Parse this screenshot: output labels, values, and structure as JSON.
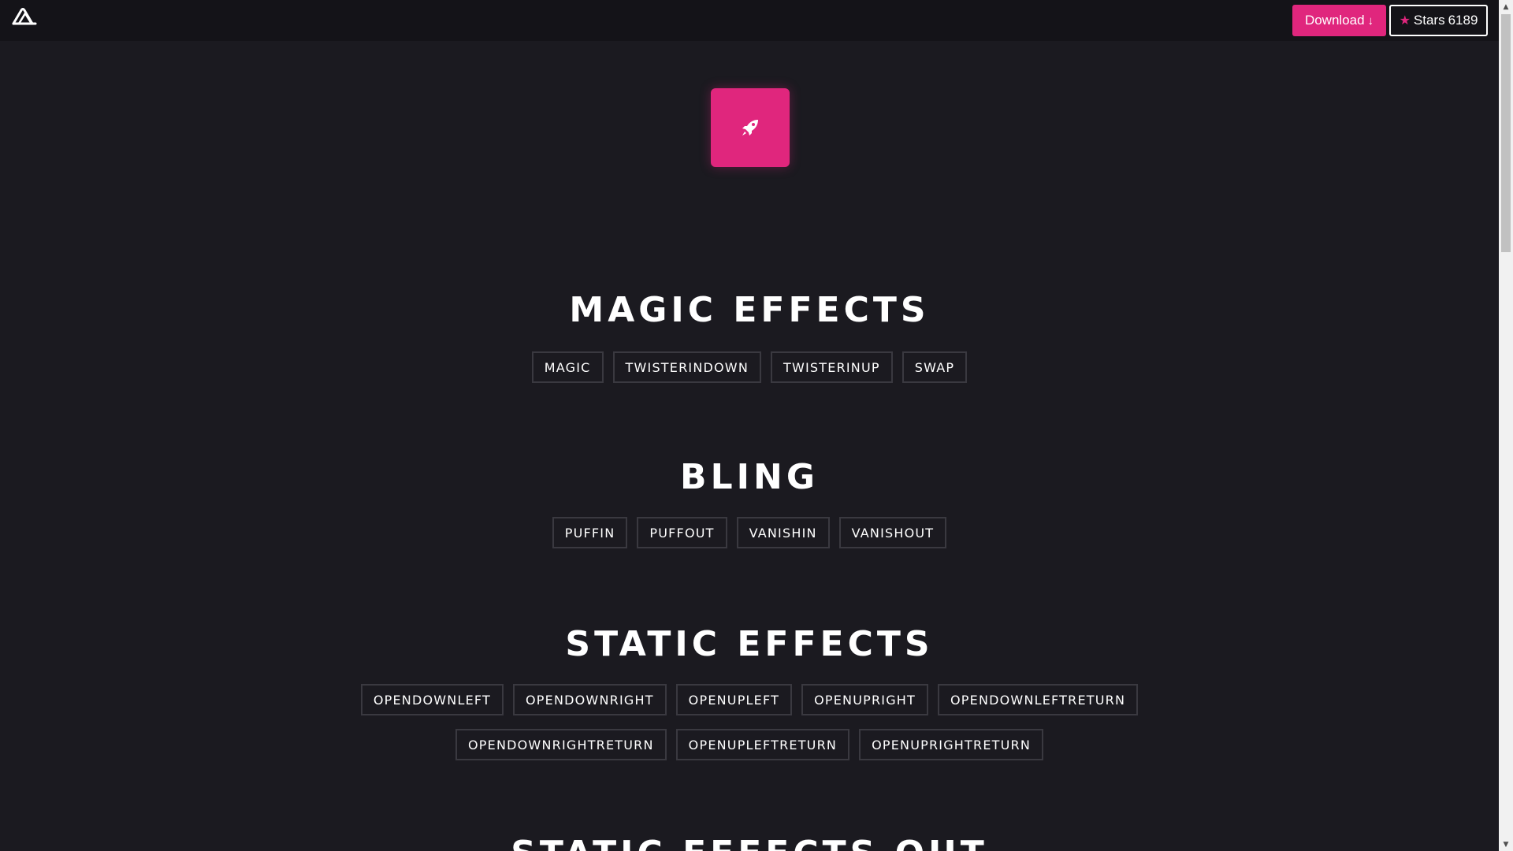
{
  "header": {
    "download_label": "Download",
    "stars_label": "Stars",
    "stars_count": "6189"
  },
  "hero": {
    "icon": "rocket-icon"
  },
  "sections": [
    {
      "title": "MAGIC EFFECTS",
      "rows": [
        [
          "MAGIC",
          "TWISTERINDOWN",
          "TWISTERINUP",
          "SWAP"
        ]
      ]
    },
    {
      "title": "BLING",
      "rows": [
        [
          "PUFFIN",
          "PUFFOUT",
          "VANISHIN",
          "VANISHOUT"
        ]
      ]
    },
    {
      "title": "STATIC EFFECTS",
      "rows": [
        [
          "OPENDOWNLEFT",
          "OPENDOWNRIGHT",
          "OPENUPLEFT",
          "OPENUPRIGHT",
          "OPENDOWNLEFTRETURN"
        ],
        [
          "OPENDOWNRIGHTRETURN",
          "OPENUPLEFTRETURN",
          "OPENUPRIGHTRETURN"
        ]
      ]
    },
    {
      "title": "STATIC EFFECTS OUT",
      "rows": []
    }
  ],
  "colors": {
    "accent": "#e0267d",
    "background": "#1b1a20",
    "topbar": "#141318",
    "button_border": "#3a3940"
  }
}
